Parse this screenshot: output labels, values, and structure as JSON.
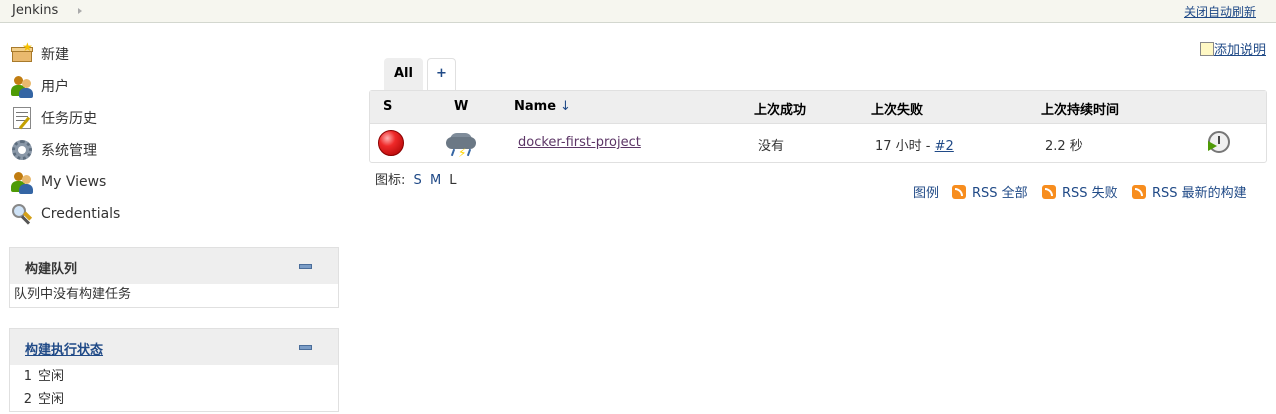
{
  "header": {
    "breadcrumb": "Jenkins",
    "auto_refresh": "关闭自动刷新"
  },
  "sidebar": {
    "tasks": [
      {
        "label": "新建",
        "icon": "new-item-icon"
      },
      {
        "label": "用户",
        "icon": "users-icon"
      },
      {
        "label": "任务历史",
        "icon": "build-history-icon"
      },
      {
        "label": "系统管理",
        "icon": "gear-icon"
      },
      {
        "label": "My Views",
        "icon": "users-icon"
      },
      {
        "label": "Credentials",
        "icon": "credentials-icon"
      }
    ],
    "queue": {
      "title": "构建队列",
      "empty": "队列中没有构建任务"
    },
    "executors": {
      "title": "构建执行状态",
      "rows": [
        {
          "num": "1",
          "status": "空闲"
        },
        {
          "num": "2",
          "status": "空闲"
        }
      ]
    }
  },
  "main": {
    "add_description": "添加说明",
    "tabs": {
      "all": "All",
      "add": "+"
    },
    "table": {
      "columns": {
        "s": "S",
        "w": "W",
        "name": "Name",
        "sort_arrow": "↓",
        "last_success": "上次成功",
        "last_failure": "上次失败",
        "last_duration": "上次持续时间"
      },
      "rows": [
        {
          "status_color": "red",
          "weather": "storm-icon",
          "name": "docker-first-project",
          "last_success": "没有",
          "last_failure_time": "17 小时 - ",
          "last_failure_build": "#2",
          "last_duration": "2.2 秒"
        }
      ]
    },
    "icon_size": {
      "label": "图标:",
      "s": "S",
      "m": "M",
      "l": "L"
    },
    "footer": {
      "legend": "图例",
      "rss_all": "RSS 全部",
      "rss_failed": "RSS 失败",
      "rss_latest": "RSS 最新的构建"
    }
  },
  "colors": {
    "link": "#204a87",
    "header_bg": "#f6f6ef",
    "table_header_bg": "#eeeeee",
    "status_failed": "#ef2929"
  }
}
